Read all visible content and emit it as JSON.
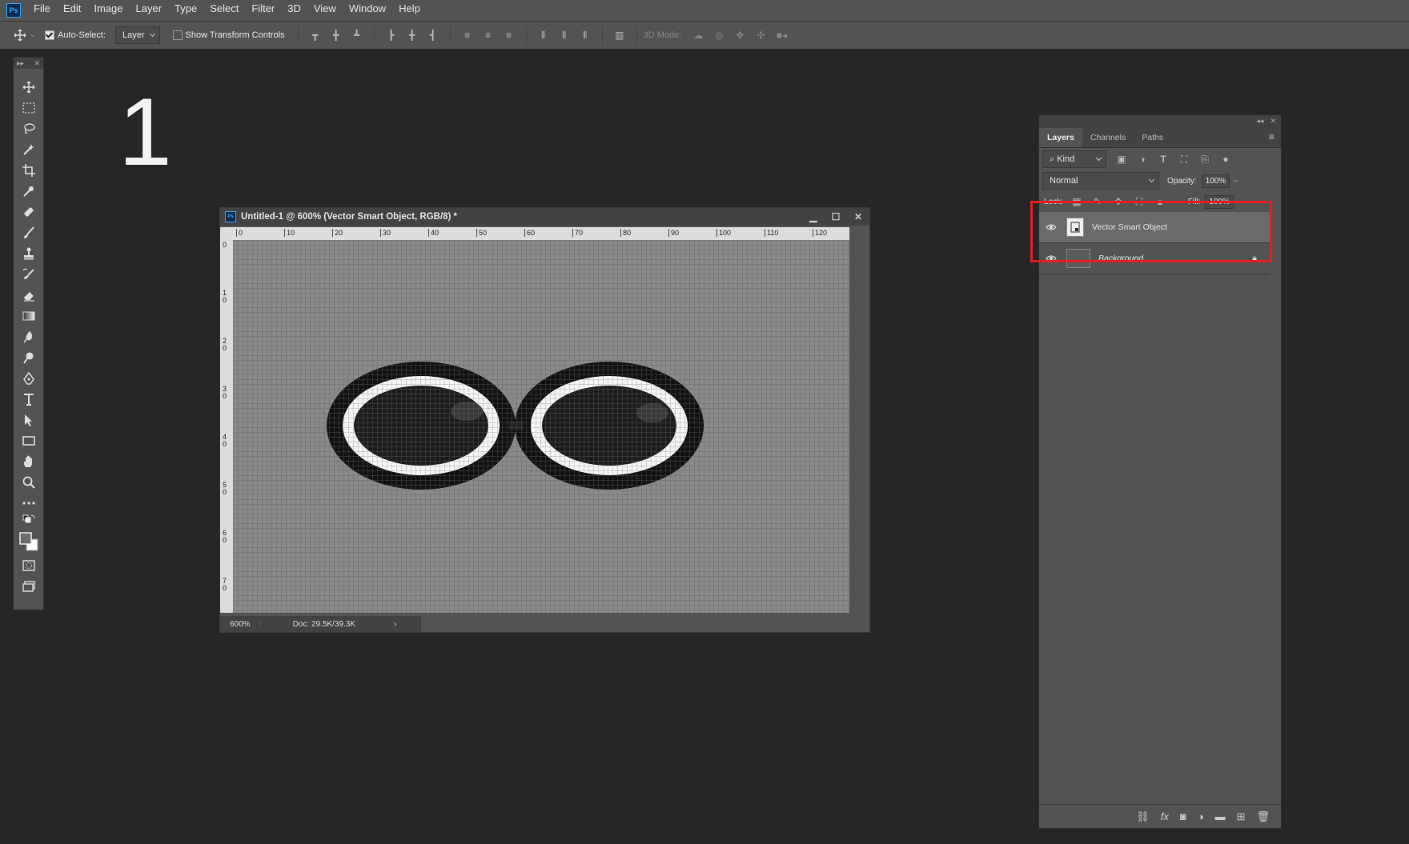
{
  "menubar": {
    "logo": "Ps",
    "items": [
      "File",
      "Edit",
      "Image",
      "Layer",
      "Type",
      "Select",
      "Filter",
      "3D",
      "View",
      "Window",
      "Help"
    ]
  },
  "options": {
    "auto_select_label": "Auto-Select:",
    "auto_select_target": "Layer",
    "show_transform_label": "Show Transform Controls",
    "mode_3d_label": "3D Mode:"
  },
  "annotation": {
    "number": "1"
  },
  "document": {
    "title": "Untitled-1 @ 600% (Vector Smart Object, RGB/8) *",
    "icon": "Ps",
    "zoom": "600%",
    "doc_size": "Doc: 29.5K/39.3K",
    "ruler_h": [
      "0",
      "10",
      "20",
      "30",
      "40",
      "50",
      "60",
      "70",
      "80",
      "90",
      "100",
      "110",
      "120"
    ],
    "ruler_v": [
      "0",
      "1 0",
      "2 0",
      "3 0",
      "4 0",
      "5 0",
      "6 0",
      "7 0"
    ]
  },
  "layers_panel": {
    "tabs": [
      "Layers",
      "Channels",
      "Paths"
    ],
    "active_tab": "Layers",
    "filter_kind": "Kind",
    "blend_mode": "Normal",
    "opacity_label": "Opacity:",
    "opacity_value": "100%",
    "lock_label": "Lock:",
    "fill_label": "Fill:",
    "fill_value": "100%",
    "layers": [
      {
        "name": "Vector Smart Object",
        "selected": true
      },
      {
        "name": "Background",
        "selected": false,
        "locked": true
      }
    ]
  },
  "colors": {
    "highlight_box": "#e02020",
    "workspace": "#262626",
    "panel": "#535353"
  }
}
